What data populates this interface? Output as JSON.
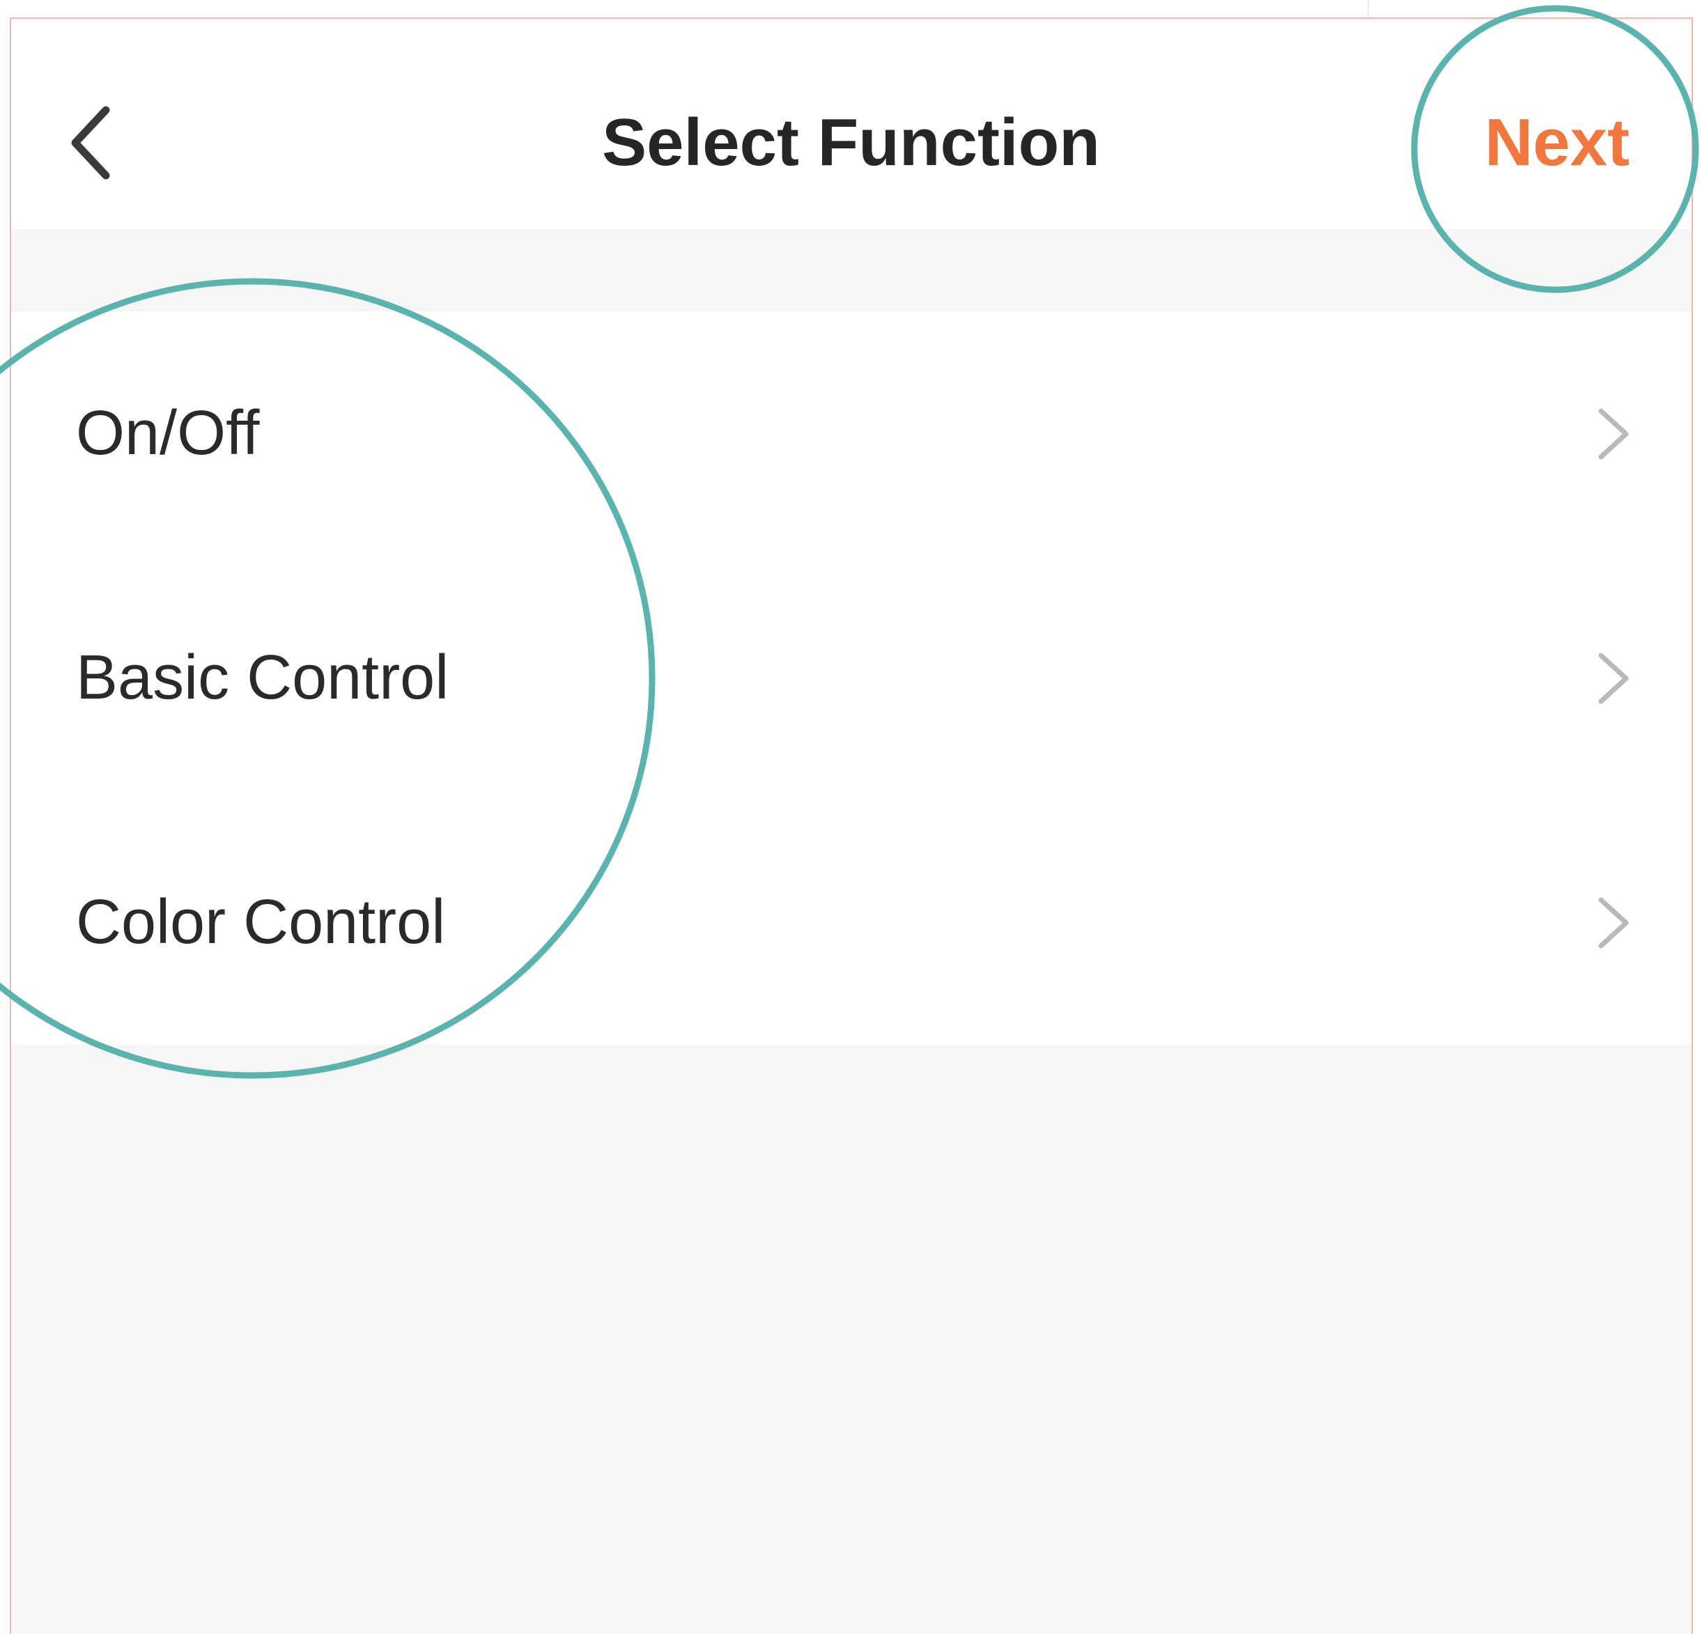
{
  "header": {
    "title": "Select Function",
    "next_label": "Next",
    "back_icon": "chevron-left-icon"
  },
  "functions": {
    "items": [
      {
        "label": "On/Off",
        "icon": "chevron-right-icon"
      },
      {
        "label": "Basic Control",
        "icon": "chevron-right-icon"
      },
      {
        "label": "Color Control",
        "icon": "chevron-right-icon"
      }
    ]
  },
  "colors": {
    "accent": "#f0773d",
    "annotation": "#5ab3ad",
    "background_gray": "#f7f6f7",
    "text": "#262626",
    "chevron": "#b9b9b9"
  }
}
